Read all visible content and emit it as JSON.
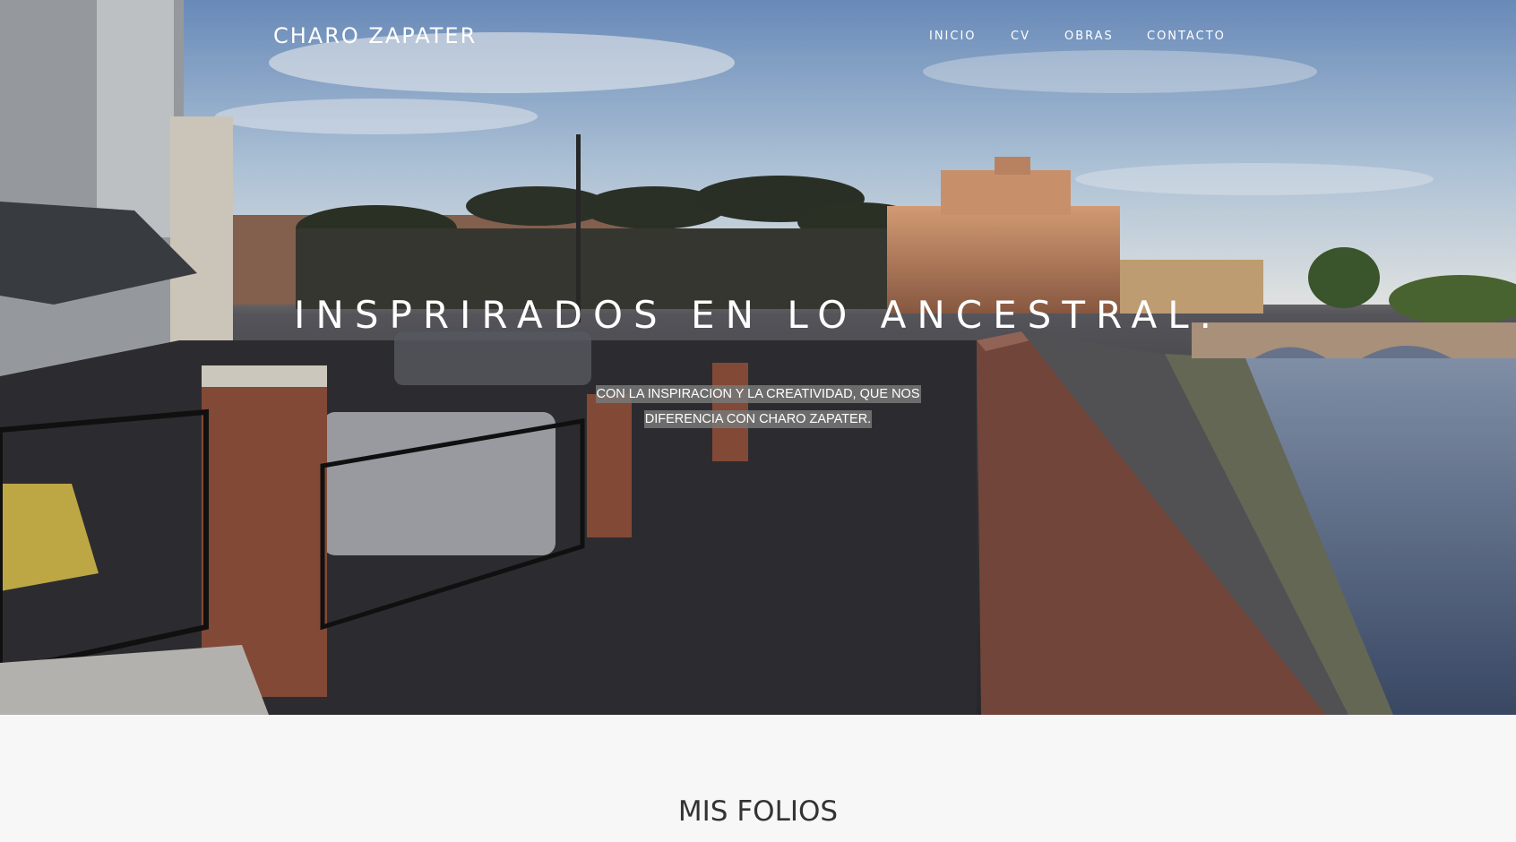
{
  "brand": {
    "name": "CHARO ZAPATER"
  },
  "nav": {
    "items": [
      {
        "label": "INICIO"
      },
      {
        "label": "CV"
      },
      {
        "label": "OBRAS"
      },
      {
        "label": "CONTACTO"
      }
    ]
  },
  "hero": {
    "headline": "INSPRIRADOS EN LO ANCESTRAL.",
    "subtitle": "CON LA INSPIRACION Y LA CREATIVIDAD, QUE NOS DIFERENCIA CON CHARO ZAPATER.",
    "image": "rome-castel-sant-angelo-panorama"
  },
  "section": {
    "title": "MIS FOLIOS"
  },
  "colors": {
    "text_on_hero": "#ffffff",
    "section_bg": "#f7f7f7",
    "section_title": "#333333"
  }
}
